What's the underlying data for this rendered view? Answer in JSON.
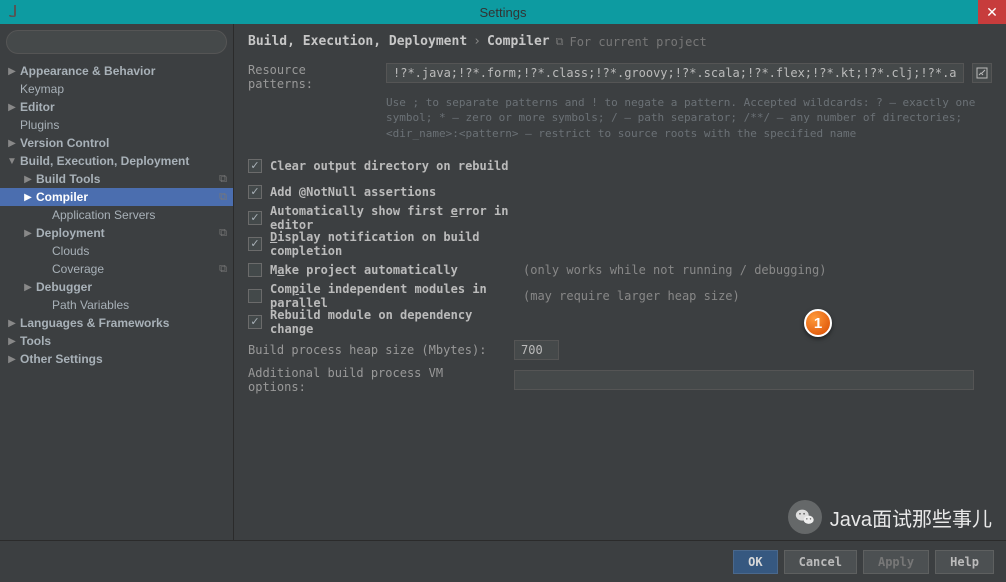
{
  "titlebar": {
    "title": "Settings"
  },
  "search": {
    "placeholder": ""
  },
  "tree": {
    "items": [
      {
        "label": "Appearance & Behavior",
        "lvl": 0,
        "arrow": "▶",
        "badge": ""
      },
      {
        "label": "Keymap",
        "lvl": 0,
        "arrow": "",
        "badge": "",
        "leaf": true
      },
      {
        "label": "Editor",
        "lvl": 0,
        "arrow": "▶",
        "badge": ""
      },
      {
        "label": "Plugins",
        "lvl": 0,
        "arrow": "",
        "badge": "",
        "leaf": true
      },
      {
        "label": "Version Control",
        "lvl": 0,
        "arrow": "▶",
        "badge": ""
      },
      {
        "label": "Build, Execution, Deployment",
        "lvl": 0,
        "arrow": "▼",
        "badge": ""
      },
      {
        "label": "Build Tools",
        "lvl": 1,
        "arrow": "▶",
        "badge": "⧉"
      },
      {
        "label": "Compiler",
        "lvl": 1,
        "arrow": "▶",
        "badge": "⧉",
        "selected": true
      },
      {
        "label": "Application Servers",
        "lvl": 2,
        "arrow": "",
        "badge": "",
        "leaf": true
      },
      {
        "label": "Deployment",
        "lvl": 1,
        "arrow": "▶",
        "badge": "⧉"
      },
      {
        "label": "Clouds",
        "lvl": 2,
        "arrow": "",
        "badge": "",
        "leaf": true
      },
      {
        "label": "Coverage",
        "lvl": 2,
        "arrow": "",
        "badge": "⧉",
        "leaf": true
      },
      {
        "label": "Debugger",
        "lvl": 1,
        "arrow": "▶",
        "badge": ""
      },
      {
        "label": "Path Variables",
        "lvl": 2,
        "arrow": "",
        "badge": "",
        "leaf": true
      },
      {
        "label": "Languages & Frameworks",
        "lvl": 0,
        "arrow": "▶",
        "badge": ""
      },
      {
        "label": "Tools",
        "lvl": 0,
        "arrow": "▶",
        "badge": ""
      },
      {
        "label": "Other Settings",
        "lvl": 0,
        "arrow": "▶",
        "badge": ""
      }
    ]
  },
  "breadcrumb": {
    "path1": "Build, Execution, Deployment",
    "sep": "›",
    "path2": "Compiler",
    "note": "For current project"
  },
  "resource": {
    "label": "Resource patterns:",
    "value": "!?*.java;!?*.form;!?*.class;!?*.groovy;!?*.scala;!?*.flex;!?*.kt;!?*.clj;!?*.aj",
    "help": "Use ; to separate patterns and ! to negate a pattern. Accepted wildcards: ? — exactly one symbol; * — zero or more symbols; / — path separator; /**/ — any number of directories; <dir_name>:<pattern> — restrict to source roots with the specified name"
  },
  "checks": [
    {
      "checked": true,
      "label_html": "Clear output directory on rebuild",
      "hint": ""
    },
    {
      "checked": true,
      "label_html": "Add @NotNull assertions",
      "hint": ""
    },
    {
      "checked": true,
      "label_html": "Automatically show first error in editor",
      "hint": ""
    },
    {
      "checked": true,
      "label_html": "Display notification on build completion",
      "hint": ""
    },
    {
      "checked": false,
      "label_html": "Make project automatically",
      "hint": "(only works while not running / debugging)"
    },
    {
      "checked": false,
      "label_html": "Compile independent modules in parallel",
      "hint": "(may require larger heap size)"
    },
    {
      "checked": true,
      "label_html": "Rebuild module on dependency change",
      "hint": ""
    }
  ],
  "heap": {
    "label": "Build process heap size (Mbytes):",
    "value": "700"
  },
  "vm": {
    "label": "Additional build process VM options:",
    "value": ""
  },
  "marker": {
    "num": "1"
  },
  "footer": {
    "ok": "OK",
    "cancel": "Cancel",
    "apply": "Apply",
    "help": "Help"
  },
  "watermark": {
    "text": "Java面试那些事儿"
  }
}
